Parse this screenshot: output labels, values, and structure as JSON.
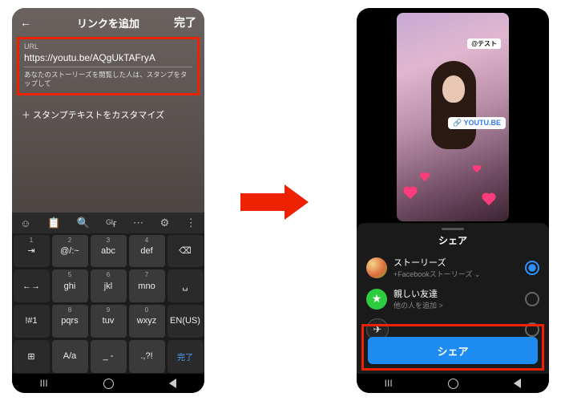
{
  "left": {
    "header_title": "リンクを追加",
    "back": "←",
    "done": "完了",
    "url_label": "URL",
    "url_value": "https://youtu.be/AQgUkTAFryA",
    "hint": "あなたのストーリーズを閲覧した人は、スタンプをタップして",
    "customize": "＋ スタンプテキストをカスタマイズ",
    "kb_toolbar": [
      "☺",
      "📋",
      "🔍",
      "ᴳᴵғ",
      "⋯",
      "⚙",
      "⋮"
    ],
    "kb_rows": [
      [
        {
          "n": "1",
          "l": "⇥",
          "d": true
        },
        {
          "n": "2",
          "l": "@/:~"
        },
        {
          "n": "3",
          "l": "abc"
        },
        {
          "n": "4",
          "l": "def"
        },
        {
          "n": "",
          "l": "⌫",
          "d": true
        }
      ],
      [
        {
          "n": "",
          "l": "←→",
          "d": true
        },
        {
          "n": "5",
          "l": "ghi"
        },
        {
          "n": "6",
          "l": "jkl"
        },
        {
          "n": "7",
          "l": "mno"
        },
        {
          "n": "",
          "l": "␣",
          "d": true
        }
      ],
      [
        {
          "n": "",
          "l": "!#1",
          "d": true
        },
        {
          "n": "8",
          "l": "pqrs"
        },
        {
          "n": "9",
          "l": "tuv"
        },
        {
          "n": "0",
          "l": "wxyz"
        },
        {
          "n": "",
          "l": "EN(US)",
          "d": true
        }
      ],
      [
        {
          "n": "",
          "l": "⊞",
          "d": true
        },
        {
          "n": "",
          "l": "A/a"
        },
        {
          "n": "",
          "l": "_ -"
        },
        {
          "n": "",
          "l": ".,?!"
        },
        {
          "n": "",
          "l": "完了",
          "enter": true
        }
      ]
    ]
  },
  "right": {
    "story_tag": "@テスト",
    "link_sticker": "🔗 YOUTU.BE",
    "sheet_title": "シェア",
    "rows": [
      {
        "title": "ストーリーズ",
        "sub": "+Facebookストーリーズ ⌄",
        "selected": true,
        "icon": "story"
      },
      {
        "title": "親しい友達",
        "sub": "他の人を追加 >",
        "selected": false,
        "icon": "close"
      },
      {
        "title": "",
        "sub": "",
        "selected": false,
        "icon": "msg"
      }
    ],
    "share_button": "シェア"
  },
  "nav": [
    "III",
    "○",
    "◁"
  ]
}
